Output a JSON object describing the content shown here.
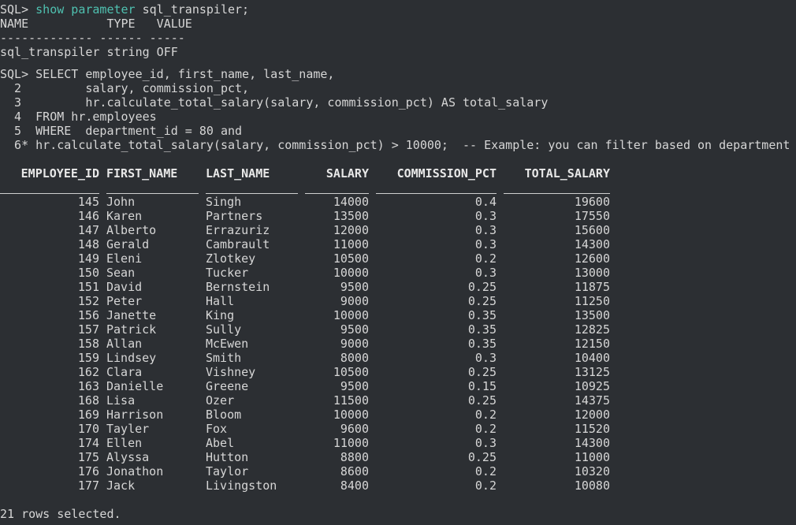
{
  "terminal": {
    "param_prompt": "SQL>",
    "param_cmd_keyword": "show parameter",
    "param_cmd_rest": "sql_transpiler;",
    "param_header": "NAME           TYPE   VALUE",
    "param_dashes": "------------- ------ -----",
    "param_row": "sql_transpiler string OFF",
    "query_lines": [
      "SQL> SELECT employee_id, first_name, last_name,",
      "  2         salary, commission_pct,",
      "  3         hr.calculate_total_salary(salary, commission_pct) AS total_salary",
      "  4  FROM hr.employees",
      "  5  WHERE  department_id = 80 and",
      "  6* hr.calculate_total_salary(salary, commission_pct) > 10000;  -- Example: you can filter based on department"
    ],
    "footer": "21 rows selected."
  },
  "result": {
    "columns": [
      "EMPLOYEE_ID",
      "FIRST_NAME",
      "LAST_NAME",
      "SALARY",
      "COMMISSION_PCT",
      "TOTAL_SALARY"
    ],
    "rows": [
      [
        "145",
        "John",
        "Singh",
        "14000",
        "0.4",
        "19600"
      ],
      [
        "146",
        "Karen",
        "Partners",
        "13500",
        "0.3",
        "17550"
      ],
      [
        "147",
        "Alberto",
        "Errazuriz",
        "12000",
        "0.3",
        "15600"
      ],
      [
        "148",
        "Gerald",
        "Cambrault",
        "11000",
        "0.3",
        "14300"
      ],
      [
        "149",
        "Eleni",
        "Zlotkey",
        "10500",
        "0.2",
        "12600"
      ],
      [
        "150",
        "Sean",
        "Tucker",
        "10000",
        "0.3",
        "13000"
      ],
      [
        "151",
        "David",
        "Bernstein",
        "9500",
        "0.25",
        "11875"
      ],
      [
        "152",
        "Peter",
        "Hall",
        "9000",
        "0.25",
        "11250"
      ],
      [
        "156",
        "Janette",
        "King",
        "10000",
        "0.35",
        "13500"
      ],
      [
        "157",
        "Patrick",
        "Sully",
        "9500",
        "0.35",
        "12825"
      ],
      [
        "158",
        "Allan",
        "McEwen",
        "9000",
        "0.35",
        "12150"
      ],
      [
        "159",
        "Lindsey",
        "Smith",
        "8000",
        "0.3",
        "10400"
      ],
      [
        "162",
        "Clara",
        "Vishney",
        "10500",
        "0.25",
        "13125"
      ],
      [
        "163",
        "Danielle",
        "Greene",
        "9500",
        "0.15",
        "10925"
      ],
      [
        "168",
        "Lisa",
        "Ozer",
        "11500",
        "0.25",
        "14375"
      ],
      [
        "169",
        "Harrison",
        "Bloom",
        "10000",
        "0.2",
        "12000"
      ],
      [
        "170",
        "Tayler",
        "Fox",
        "9600",
        "0.2",
        "11520"
      ],
      [
        "174",
        "Ellen",
        "Abel",
        "11000",
        "0.3",
        "14300"
      ],
      [
        "175",
        "Alyssa",
        "Hutton",
        "8800",
        "0.25",
        "11000"
      ],
      [
        "176",
        "Jonathon",
        "Taylor",
        "8600",
        "0.2",
        "10320"
      ],
      [
        "177",
        "Jack",
        "Livingston",
        "8400",
        "0.2",
        "10080"
      ]
    ]
  },
  "colors": {
    "background": "#2c2f33",
    "text": "#d6d6d6",
    "keyword": "#4fc1b0"
  }
}
